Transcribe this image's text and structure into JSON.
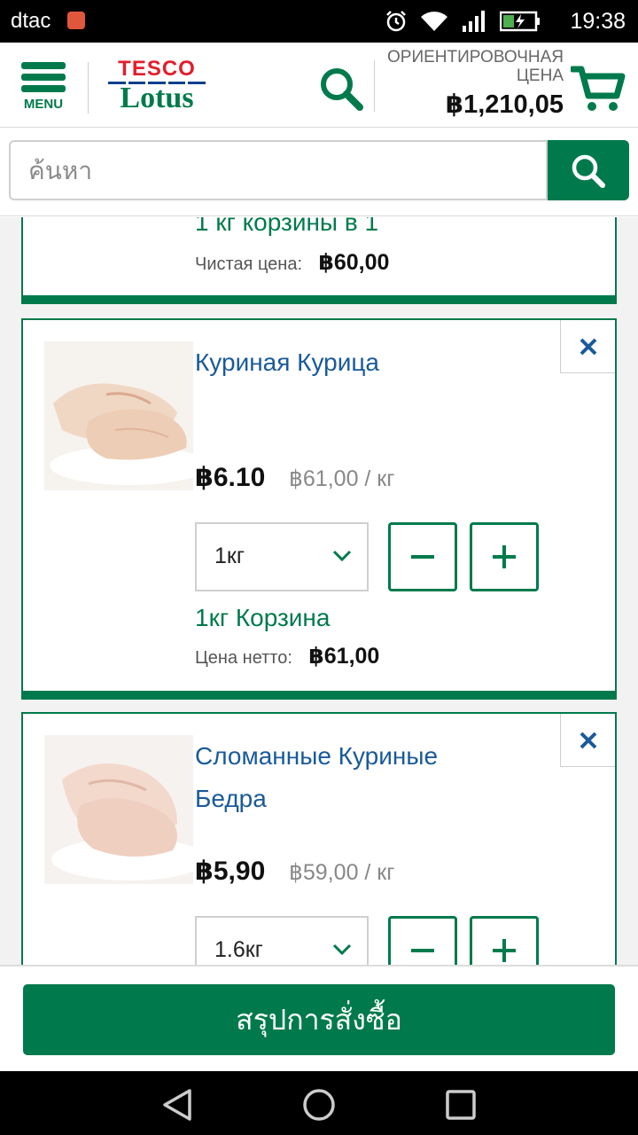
{
  "status_bar": {
    "carrier": "dtac",
    "time": "19:38",
    "icons": [
      "alarm-icon",
      "wifi-icon",
      "signal-icon",
      "battery-charging-icon"
    ]
  },
  "header": {
    "menu_label": "MENU",
    "logo_top": "TESCO",
    "logo_bottom": "Lotus",
    "estimated_price_label_1": "ОРИЕНТИРОВОЧНАЯ",
    "estimated_price_label_2": "ЦЕНА",
    "estimated_price": "฿1,210,05"
  },
  "search": {
    "placeholder": "ค้นหา",
    "value": ""
  },
  "previous_item": {
    "basket_line": "1 кг корзины в 1",
    "net_label": "Чистая цена:",
    "net_price": "฿60,00"
  },
  "items": [
    {
      "name": "Куриная Курица",
      "price": "฿6.10",
      "unit_price": "฿61,00 / кг",
      "quantity": "1кг",
      "basket_line": "1кг Корзина",
      "net_label": "Цена нетто:",
      "net_price": "฿61,00"
    },
    {
      "name_line1": "Сломанные Куриные",
      "name_line2": "Бедра",
      "price": "฿5,90",
      "unit_price": "฿59,00 / кг",
      "quantity": "1.6кг"
    }
  ],
  "footer": {
    "checkout_label": "สรุปการสั่งซื้อ"
  },
  "colors": {
    "brand_green": "#007a4c",
    "tesco_red": "#e21e2b",
    "link_blue": "#1a5a9a"
  }
}
